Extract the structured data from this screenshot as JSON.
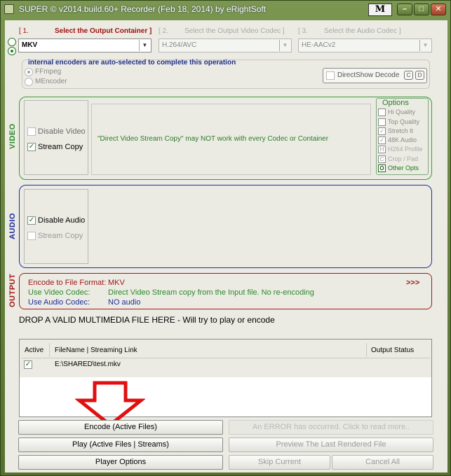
{
  "window": {
    "title": "SUPER © v2014.build.60+ Recorder (Feb 18, 2014) by eRightSoft",
    "m_label": "M",
    "min_symbol": "–",
    "max_symbol": "□",
    "close_symbol": "✕"
  },
  "steps": {
    "step1_num": "[ 1.",
    "step1_label": "Select the Output Container ]",
    "step2_num": "[ 2.",
    "step2_label": "Select the Output Video Codec ]",
    "step3_num": "[ 3.",
    "step3_label": "Select the Audio Codec ]"
  },
  "combos": {
    "container": "MKV",
    "video_codec": "H.264/AVC",
    "audio_codec": "HE-AACv2",
    "arrow": "▼"
  },
  "encoders": {
    "header": "internal encoders are auto-selected to complete this operation",
    "ffmpeg": "FFmpeg",
    "mencoder": "MEncoder",
    "directshow": "DirectShow Decode",
    "c_label": "C",
    "d_label": "D"
  },
  "video": {
    "side_label": "VIDEO",
    "disable_video": "Disable Video",
    "stream_copy": "Stream Copy",
    "message": "\"Direct Video Stream Copy\" may NOT work with every Codec or Container",
    "options_title": "Options",
    "opt_hi_quality": "Hi Quality",
    "opt_top_quality": "Top Quality",
    "opt_stretch": "Stretch It",
    "opt_48k": "48K Audio",
    "opt_h264_profile": "H264 Profile",
    "opt_crop_pad": "Crop / Pad",
    "opt_other": "Other Opts",
    "h_key": "H",
    "c_key": "C",
    "o_key": "O"
  },
  "audio": {
    "side_label": "AUDIO",
    "disable_audio": "Disable Audio",
    "stream_copy": "Stream Copy"
  },
  "output": {
    "side_label": "OUTPUT",
    "format_label": "Encode to File Format:",
    "format_value": "MKV",
    "more": ">>>",
    "video_codec_label": "Use Video Codec:",
    "video_codec_value": "Direct Video Stream copy from the Input file. No re-encoding",
    "audio_codec_label": "Use Audio Codec:",
    "audio_codec_value": "NO audio"
  },
  "drop_message": "DROP A VALID MULTIMEDIA FILE HERE - Will try to play or encode",
  "files_table": {
    "col_active": "Active",
    "col_filename": "FileName  |  Streaming Link",
    "col_status": "Output Status",
    "rows": [
      {
        "file": "E:\\SHARED\\test.mkv",
        "status": ""
      }
    ]
  },
  "buttons": {
    "encode": "Encode (Active Files)",
    "error": "An ERROR has occurred. Click to read more..",
    "play": "Play (Active Files | Streams)",
    "preview": "Preview The Last Rendered File",
    "player_options": "Player Options",
    "skip": "Skip Current",
    "cancel": "Cancel All"
  },
  "colors": {
    "video_border": "#3a9a3a",
    "audio_border": "#1e2e9a",
    "output_border": "#a01818",
    "arrow_red": "#e01010"
  }
}
